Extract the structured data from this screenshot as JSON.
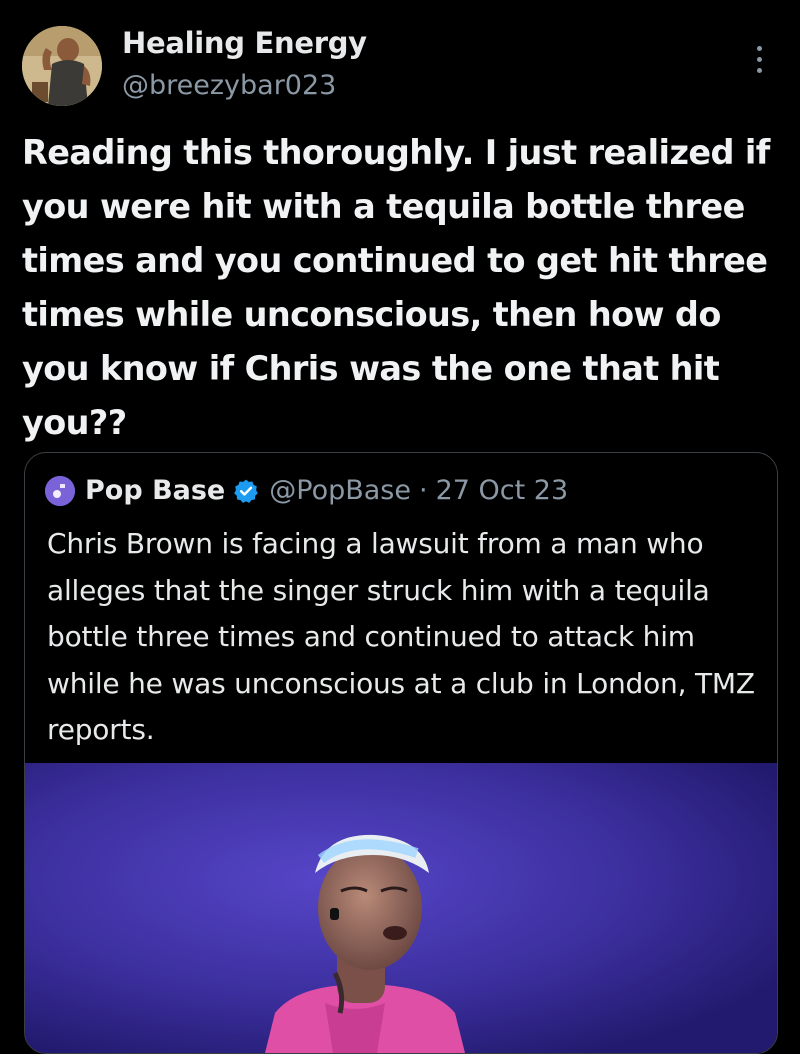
{
  "author": {
    "display_name": "Healing Energy",
    "handle": "@breezybar023"
  },
  "tweet": {
    "text": "Reading this thoroughly. I just realized if you were hit with a tequila bottle three times and you continued to get hit three times while unconscious, then how do you know if Chris was the one that hit you??"
  },
  "quote": {
    "display_name": "Pop Base",
    "handle": "@PopBase",
    "separator": "·",
    "date": "27 Oct 23",
    "text": "Chris Brown is facing a lawsuit from a man who alleges that the singer struck him with a tequila bottle three times and continued to attack him while he was unconscious at a club in London, TMZ reports."
  },
  "icons": {
    "more": "more-vertical-icon",
    "verified": "verified-badge-icon"
  },
  "colors": {
    "background": "#000000",
    "text": "#e7e9ea",
    "secondary_text": "#8b98a5",
    "verified": "#1d9bf0",
    "border": "#3a3f44"
  }
}
